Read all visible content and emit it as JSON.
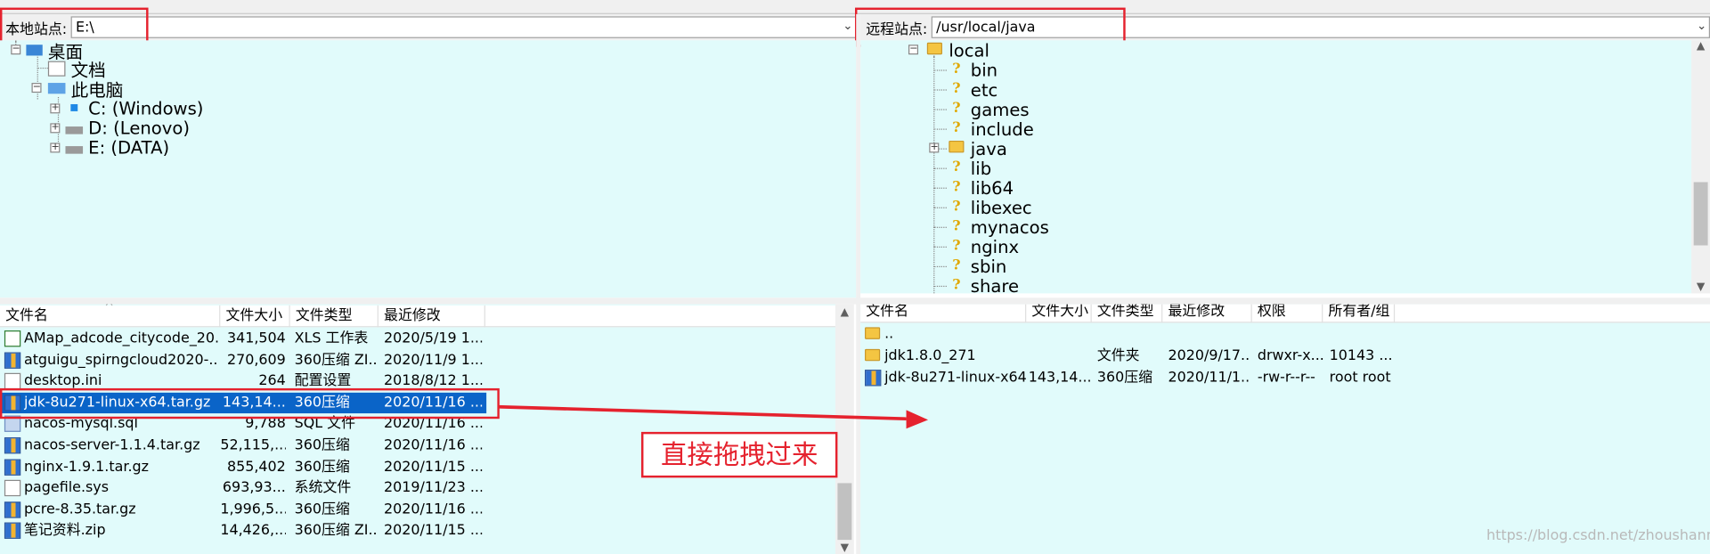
{
  "local": {
    "site_label": "本地站点:",
    "site_path": "E:\\",
    "tree": {
      "desktop": "桌面",
      "documents": "文档",
      "this_pc": "此电脑",
      "drive_c": "C: (Windows)",
      "drive_d": "D: (Lenovo)",
      "drive_e": "E: (DATA)"
    },
    "columns": [
      "文件名",
      "文件大小",
      "文件类型",
      "最近修改"
    ],
    "files": [
      {
        "name": "AMap_adcode_citycode_20...",
        "size": "341,504",
        "type": "XLS 工作表",
        "modified": "2020/5/19 1...",
        "icon": "xls"
      },
      {
        "name": "atguigu_spirngcloud2020-...",
        "size": "270,609",
        "type": "360压缩 ZI...",
        "modified": "2020/11/9 1...",
        "icon": "zip"
      },
      {
        "name": "desktop.ini",
        "size": "264",
        "type": "配置设置",
        "modified": "2018/8/12 1...",
        "icon": "doc"
      },
      {
        "name": "jdk-8u271-linux-x64.tar.gz",
        "size": "143,14...",
        "type": "360压缩",
        "modified": "2020/11/16 ...",
        "icon": "zip"
      },
      {
        "name": "nacos-mysql.sql",
        "size": "9,788",
        "type": "SQL 文件",
        "modified": "2020/11/16 ...",
        "icon": "sql"
      },
      {
        "name": "nacos-server-1.1.4.tar.gz",
        "size": "52,115,...",
        "type": "360压缩",
        "modified": "2020/11/16 ...",
        "icon": "zip"
      },
      {
        "name": "nginx-1.9.1.tar.gz",
        "size": "855,402",
        "type": "360压缩",
        "modified": "2020/11/15 ...",
        "icon": "zip"
      },
      {
        "name": "pagefile.sys",
        "size": "693,93...",
        "type": "系统文件",
        "modified": "2019/11/23 ...",
        "icon": "doc"
      },
      {
        "name": "pcre-8.35.tar.gz",
        "size": "1,996,5...",
        "type": "360压缩",
        "modified": "2020/11/16 ...",
        "icon": "zip"
      },
      {
        "name": "笔记资料.zip",
        "size": "14,426,...",
        "type": "360压缩 ZI...",
        "modified": "2020/11/15 ...",
        "icon": "zip"
      }
    ],
    "selected_index": 3
  },
  "remote": {
    "site_label": "远程站点:",
    "site_path": "/usr/local/java",
    "tree": {
      "local": "local",
      "items": [
        "bin",
        "etc",
        "games",
        "include",
        "java",
        "lib",
        "lib64",
        "libexec",
        "mynacos",
        "nginx",
        "sbin",
        "share"
      ]
    },
    "columns": [
      "文件名",
      "文件大小",
      "文件类型",
      "最近修改",
      "权限",
      "所有者/组"
    ],
    "files": [
      {
        "name": "..",
        "size": "",
        "type": "",
        "modified": "",
        "perm": "",
        "owner": "",
        "icon": "folder"
      },
      {
        "name": "jdk1.8.0_271",
        "size": "",
        "type": "文件夹",
        "modified": "2020/9/17...",
        "perm": "drwxr-x...",
        "owner": "10143 ...",
        "icon": "folder"
      },
      {
        "name": "jdk-8u271-linux-x64....",
        "size": "143,14...",
        "type": "360压缩",
        "modified": "2020/11/1...",
        "perm": "-rw-r--r--",
        "owner": "root root",
        "icon": "zip"
      }
    ]
  },
  "annotation": {
    "text": "直接拖拽过来"
  },
  "watermark": "https://blog.csdn.net/zhoushanmin",
  "colors": {
    "pane_bg": "#e1fbfb",
    "selection": "#0a64c8",
    "annotation_red": "#e5222e"
  }
}
